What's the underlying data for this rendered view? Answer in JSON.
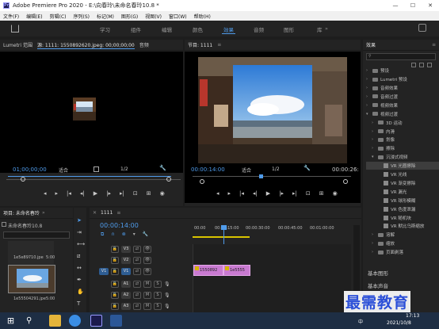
{
  "titlebar": {
    "title": "Adobe Premiere Pro 2020 - E:\\向春玲\\未命名春玲10.8 *",
    "app_icon": "Pr",
    "min": "—",
    "max": "☐",
    "close": "✕"
  },
  "menu": [
    "文件(F)",
    "编辑(E)",
    "剪辑(C)",
    "序列(S)",
    "标记(M)",
    "图形(G)",
    "视图(V)",
    "窗口(W)",
    "帮助(H)"
  ],
  "workspaces": [
    "学习",
    "组件",
    "编辑",
    "颜色",
    "效果",
    "音频",
    "图形",
    "库"
  ],
  "workspace_active": "效果",
  "source_panel": {
    "tabs": [
      "Lumetri 范围",
      "源: 1111: 1550892620.jpeg: 00;00;00;00",
      "音频"
    ],
    "timecode": "01;00;00;00",
    "fit": "适合",
    "resolution": "1/2"
  },
  "program_panel": {
    "title": "节目: 1111",
    "timecode": "00:00:14:00",
    "fit": "适合",
    "resolution": "1/2",
    "duration": "00:00:26:"
  },
  "project_panel": {
    "tab": "项目: 未命名春玲",
    "path": "未命名春玲10.8",
    "items": [
      {
        "name": "1e5e89710.jpe",
        "dur": "5:00"
      },
      {
        "name": "1e55504291.jpe",
        "dur": "5:00"
      }
    ]
  },
  "timeline": {
    "tab": "1111",
    "timecode": "00:00:14:00",
    "ruler": [
      "00:00",
      "00:00:15:00",
      "00:00:30:00",
      "00:00:45:00",
      "00:01:00:00"
    ],
    "tracks": [
      {
        "id": "V3",
        "type": "video"
      },
      {
        "id": "V2",
        "type": "video"
      },
      {
        "id": "V1",
        "type": "video",
        "src": "V1"
      },
      {
        "id": "A1",
        "type": "audio",
        "src": "A1"
      },
      {
        "id": "A2",
        "type": "audio"
      },
      {
        "id": "A3",
        "type": "audio"
      }
    ],
    "clips": [
      "1550892",
      "1e5555"
    ],
    "mute": "M",
    "solo": "S"
  },
  "effects_panel": {
    "title": "效果",
    "search_placeholder": "",
    "items": [
      {
        "label": "预设",
        "kind": "folder",
        "indent": 0
      },
      {
        "label": "Lumetri 预设",
        "kind": "folder",
        "indent": 0
      },
      {
        "label": "音频效果",
        "kind": "folder",
        "indent": 0
      },
      {
        "label": "音频过渡",
        "kind": "folder",
        "indent": 0
      },
      {
        "label": "视频效果",
        "kind": "folder",
        "indent": 0
      },
      {
        "label": "视频过渡",
        "kind": "folder",
        "indent": 0,
        "open": true
      },
      {
        "label": "3D 运动",
        "kind": "folder",
        "indent": 1
      },
      {
        "label": "内滑",
        "kind": "folder",
        "indent": 1
      },
      {
        "label": "划像",
        "kind": "folder",
        "indent": 1
      },
      {
        "label": "擦除",
        "kind": "folder",
        "indent": 1
      },
      {
        "label": "沉浸式视频",
        "kind": "folder",
        "indent": 1,
        "open": true
      },
      {
        "label": "VR 光圈擦除",
        "kind": "vr",
        "indent": 2,
        "selected": true
      },
      {
        "label": "VR 光线",
        "kind": "vr",
        "indent": 2
      },
      {
        "label": "VR 渐变擦除",
        "kind": "vr",
        "indent": 2
      },
      {
        "label": "VR 漏光",
        "kind": "vr",
        "indent": 2
      },
      {
        "label": "VR 球形模糊",
        "kind": "vr",
        "indent": 2
      },
      {
        "label": "VR 色度泄漏",
        "kind": "vr",
        "indent": 2
      },
      {
        "label": "VR 随机块",
        "kind": "vr",
        "indent": 2
      },
      {
        "label": "VR 默比乌斯缩放",
        "kind": "vr",
        "indent": 2
      },
      {
        "label": "溶解",
        "kind": "folder",
        "indent": 1
      },
      {
        "label": "缩放",
        "kind": "folder",
        "indent": 1
      },
      {
        "label": "页面剥落",
        "kind": "folder",
        "indent": 1
      }
    ],
    "bottom": [
      "基本图形",
      "基本声音"
    ]
  },
  "taskbar": {
    "time": "17:13",
    "date": "2021/10/8",
    "lang": "中"
  },
  "watermark": "最需教育"
}
